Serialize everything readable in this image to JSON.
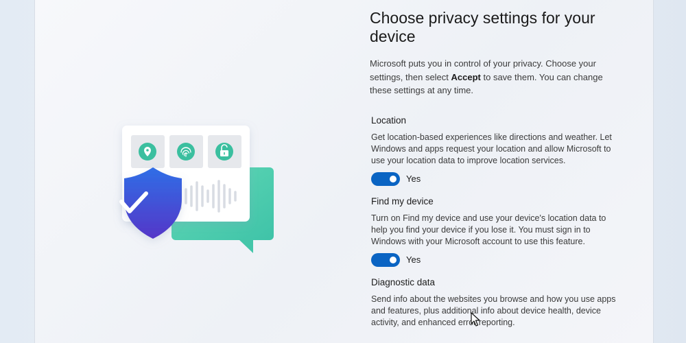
{
  "page": {
    "title": "Choose privacy settings for your device",
    "intro_before": "Microsoft puts you in control of your privacy. Choose your settings, then select ",
    "intro_bold": "Accept",
    "intro_after": " to save them. You can change these settings at any time."
  },
  "settings": [
    {
      "title": "Location",
      "description": "Get location-based experiences like directions and weather. Let Windows and apps request your location and allow Microsoft to use your location data to improve location services.",
      "toggle_state": "Yes"
    },
    {
      "title": "Find my device",
      "description": "Turn on Find my device and use your device's location data to help you find your device if you lose it. You must sign in to Windows with your Microsoft account to use this feature.",
      "toggle_state": "Yes"
    },
    {
      "title": "Diagnostic data",
      "description": "Send info about the websites you browse and how you use apps and features, plus additional info about device health, device activity, and enhanced error reporting."
    }
  ],
  "illustration": {
    "icons": [
      "location-pin-icon",
      "fingerprint-icon",
      "unlocked-padlock-icon"
    ],
    "colors": {
      "shield": "#3f55d8",
      "bubble": "#4fcfae",
      "teal": "#3bbf9f",
      "toggle_on": "#0a64c3"
    }
  }
}
